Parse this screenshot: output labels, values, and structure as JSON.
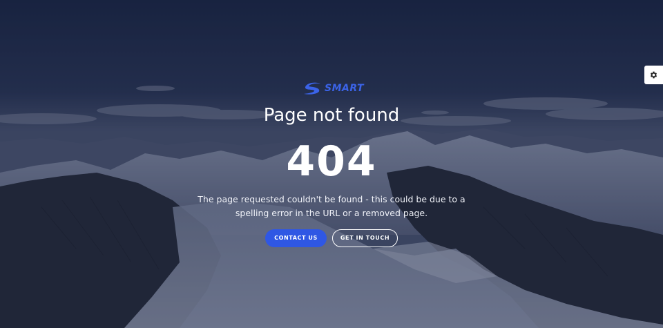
{
  "logo": {
    "text": "SMART",
    "icon": "logo-s-swoosh-icon",
    "color": "#3b63e8"
  },
  "hero": {
    "title": "Page not found",
    "code": "404",
    "description": "The page requested couldn't be found - this could be due to a spelling error in the URL or a removed page."
  },
  "buttons": {
    "contact": "CONTACT US",
    "get_in_touch": "GET IN TOUCH"
  },
  "settings": {
    "icon": "gear-icon"
  },
  "colors": {
    "accent": "#2f57e4",
    "text": "#ffffff",
    "background": "#283555"
  }
}
